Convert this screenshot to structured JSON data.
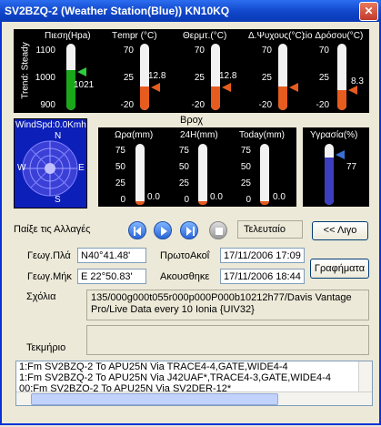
{
  "window": {
    "title": "SV2BZQ-2 (Weather Station(Blue)) KN10KQ",
    "close": "✕"
  },
  "top_gauges": {
    "trend_label": "Trend: Steady",
    "gauges": [
      {
        "label": "Πιεση(Hpa)",
        "ticks": [
          "1100",
          "1000",
          "900"
        ],
        "value": "1021",
        "level": 0.6,
        "color": "#1aa81a",
        "arrow": "#2ecc40"
      },
      {
        "label": "Τempr (°C)",
        "ticks": [
          "70",
          "25",
          "-20"
        ],
        "value": "12.8",
        "level": 0.36,
        "color": "#e65c1f",
        "arrow": "#e65c1f"
      },
      {
        "label": "Θερμτ.(°C)",
        "ticks": [
          "70",
          "25",
          "-20"
        ],
        "value": "12.8",
        "level": 0.36,
        "color": "#e65c1f",
        "arrow": "#e65c1f"
      },
      {
        "label": "Δ.Ψυχους(°C)",
        "ticks": [
          "70",
          "25",
          "-20"
        ],
        "value": "",
        "level": 0.36,
        "color": "#e65c1f",
        "arrow": "#e65c1f"
      },
      {
        "label": ":io Δρόσου(°C)",
        "ticks": [
          "70",
          "25",
          "-20"
        ],
        "value": "8.3",
        "level": 0.31,
        "color": "#e65c1f",
        "arrow": "#e65c1f"
      }
    ]
  },
  "wind": {
    "label": "WindSpd:0.0Kmh",
    "n": "N",
    "s": "S",
    "e": "E",
    "w": "W"
  },
  "rain": {
    "title": "Βροχ",
    "gauges": [
      {
        "label": "Ωρα(mm)",
        "ticks": [
          "75",
          "50",
          "25",
          "0"
        ],
        "value": "0.0"
      },
      {
        "label": "24H(mm)",
        "ticks": [
          "75",
          "50",
          "25",
          "0"
        ],
        "value": "0.0"
      },
      {
        "label": "Today(mm)",
        "ticks": [
          "75",
          "50",
          "25",
          "0"
        ],
        "value": "0.0"
      }
    ]
  },
  "humidity": {
    "label": "Υγρασία(%)",
    "value": "77",
    "level": 0.77
  },
  "playback": {
    "label": "Παίξε τις Αλλαγές",
    "last_label": "Τελευταίο",
    "prev_button": "<< Λιγο"
  },
  "position": {
    "lat_label": "Γεωγ.Πλά",
    "lat_value": "N40°41.48'",
    "lon_label": "Γεωγ.Μήκ",
    "lon_value": "E 22°50.83'",
    "first_label": "ΠρωτοΑκοΐ",
    "first_value": "17/11/2006 17:09",
    "heard_label": "Ακουσθηκε",
    "heard_value": "17/11/2006 18:44",
    "graphs_button": "Γραφήματα"
  },
  "comments": {
    "label": "Σχόλια",
    "text": "135/000g000t055r000p000P000b10212h77/Davis Vantage Pro/Live Data every 10 Ionia {UIV32}"
  },
  "evidence": {
    "label": "Τεκμήριο",
    "text": ""
  },
  "log": {
    "lines": [
      "1:Fm SV2BZQ-2 To APU25N Via TRACE4-4,GATE,WIDE4-4",
      "1:Fm SV2BZQ-2 To APU25N Via J42UAF*,TRACE4-3,GATE,WIDE4-4",
      "00:Fm SV2BZQ-2 To APU25N Via SV2DER-12*"
    ]
  }
}
